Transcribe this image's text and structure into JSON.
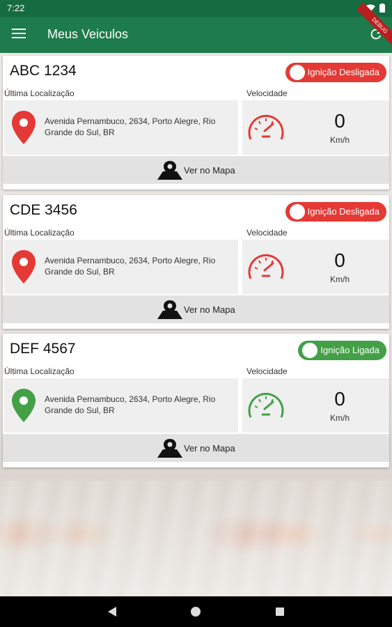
{
  "status_bar": {
    "time": "7:22"
  },
  "app_bar": {
    "title": "Meus Veiculos",
    "debug_label": "DEBUG"
  },
  "labels": {
    "location": "Última Localização",
    "speed": "Velocidade",
    "unit": "Km/h",
    "map_button": "Ver no Mapa"
  },
  "vehicles": [
    {
      "plate": "ABC 1234",
      "ignition": "Ignição Desligada",
      "ignition_state": "off",
      "address": "Avenida Pernambuco, 2634, Porto Alegre, Rio Grande do Sul, BR",
      "speed": "0"
    },
    {
      "plate": "CDE 3456",
      "ignition": "Ignição Desligada",
      "ignition_state": "off",
      "address": "Avenida Pernambuco, 2634, Porto Alegre, Rio Grande do Sul, BR",
      "speed": "0"
    },
    {
      "plate": "DEF 4567",
      "ignition": "Ignição Ligada",
      "ignition_state": "on",
      "address": "Avenida Pernambuco, 2634, Porto Alegre, Rio Grande do Sul, BR",
      "speed": "0"
    }
  ],
  "colors": {
    "status_bar": "#176b41",
    "app_bar": "#1e7b4b",
    "ignition_off": "#e53935",
    "ignition_on": "#43a047"
  },
  "icons": [
    "menu-icon",
    "refresh-icon",
    "wifi-icon",
    "battery-icon",
    "location-pin-icon",
    "speedometer-icon",
    "map-pin-icon",
    "nav-back-icon",
    "nav-home-icon",
    "nav-recent-icon"
  ]
}
